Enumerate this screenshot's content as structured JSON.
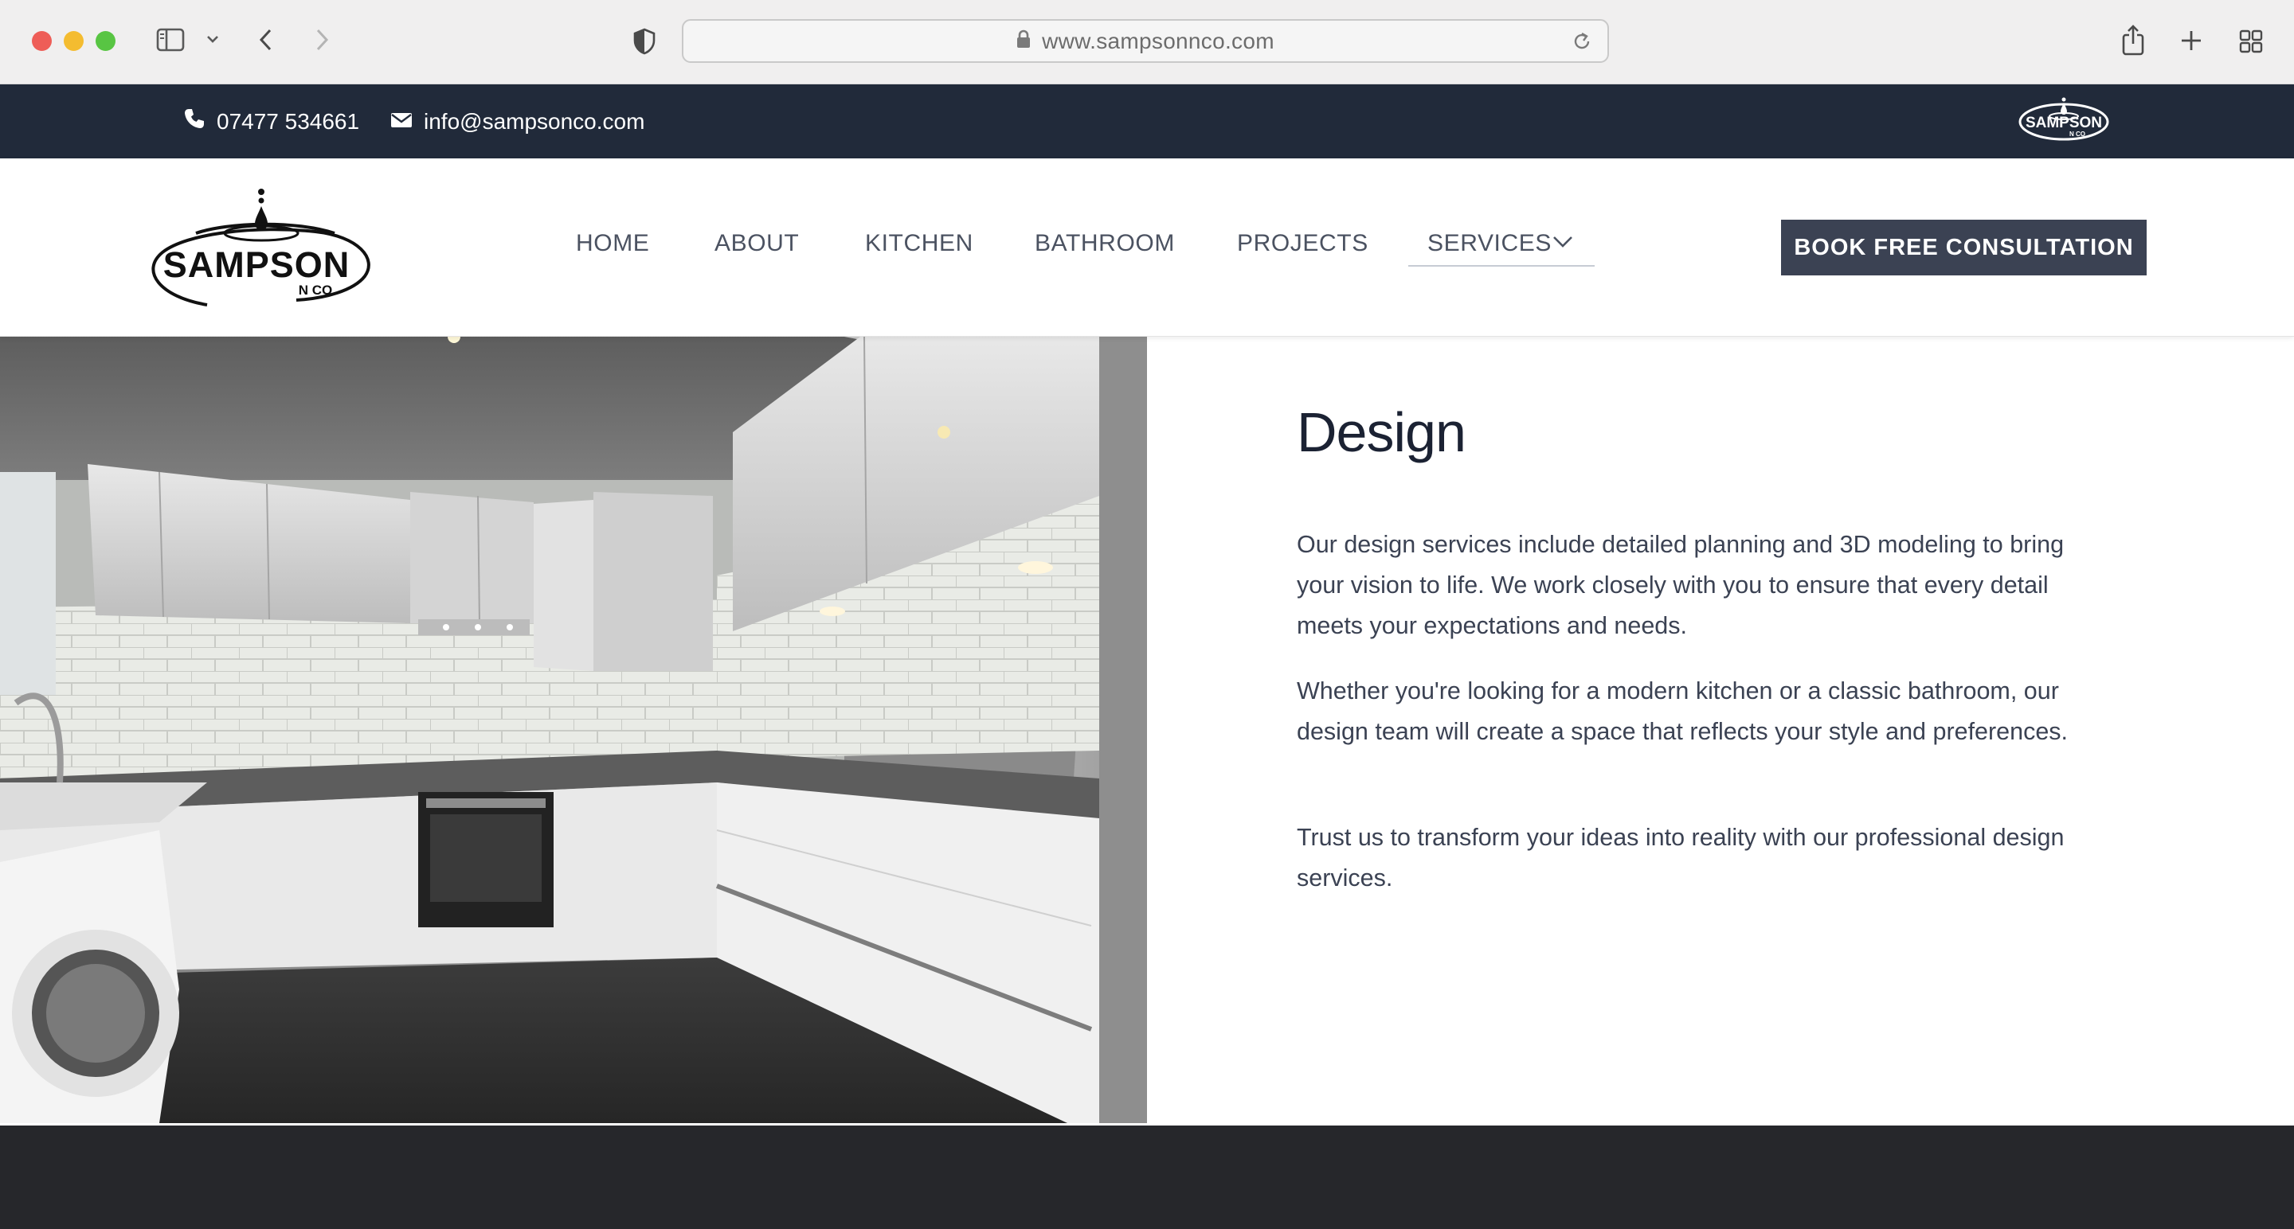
{
  "browser": {
    "url": "www.sampsonnco.com"
  },
  "topbar": {
    "phone": "07477 534661",
    "email": "info@sampsonco.com",
    "logo_text": "SAMPSON",
    "logo_subtext": "N CO"
  },
  "header": {
    "logo_text": "SAMPSON",
    "logo_subtext": "N CO",
    "nav": {
      "home": "HOME",
      "about": "ABOUT",
      "kitchen": "KITCHEN",
      "bathroom": "BATHROOM",
      "projects": "PROJECTS",
      "services": "SERVICES"
    },
    "cta_label": "BOOK FREE CONSULTATION"
  },
  "main": {
    "title": "Design",
    "paragraphs": [
      "Our design services include detailed planning and 3D modeling to bring your vision to life. We work closely with you to ensure that every detail meets your expectations and needs.",
      "Whether you're looking for a modern kitchen or a classic bathroom, our design team will create a space that reflects your style and preferences.",
      "Trust us to transform your ideas into reality with our professional design services."
    ]
  },
  "colors": {
    "topbar_bg": "#212a3a",
    "cta_bg": "#3b4253",
    "footer_bg": "#26272b",
    "nav_text": "#4b5261",
    "heading": "#1b2233"
  }
}
